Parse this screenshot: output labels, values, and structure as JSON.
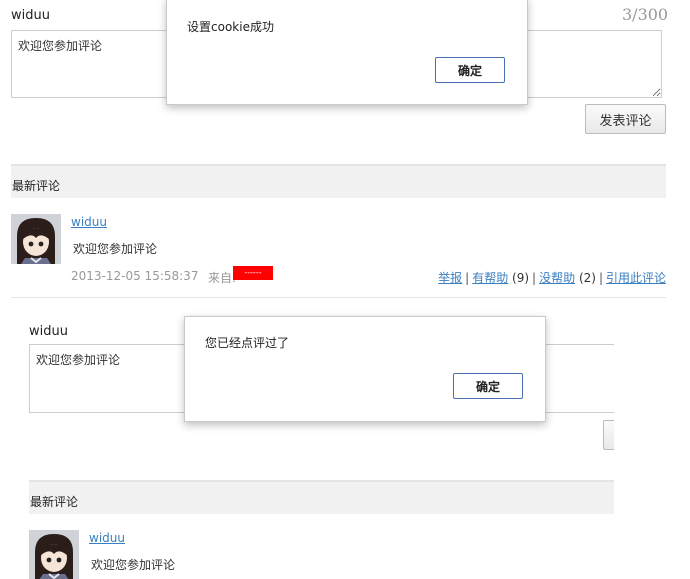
{
  "top": {
    "username": "widuu",
    "counter": "3/300",
    "comment_value": "欢迎您参加评论",
    "submit_label": "发表评论",
    "section_title": "最新评论",
    "comment": {
      "author": "widuu",
      "text": "欢迎您参加评论",
      "timestamp": "2013-12-05 15:58:37",
      "source_label": "来自:",
      "source_tag": "------",
      "actions": {
        "report": "举报",
        "helpful": "有帮助",
        "helpful_count": "(9)",
        "not_helpful": "没帮助",
        "not_helpful_count": "(2)",
        "quote": "引用此评论"
      },
      "separator": "|"
    }
  },
  "dialog_top": {
    "message": "设置cookie成功",
    "ok_label": "确定"
  },
  "bottom": {
    "username": "widuu",
    "comment_value": "欢迎您参加评论",
    "section_title": "最新评论",
    "comment": {
      "author": "widuu",
      "text": "欢迎您参加评论"
    }
  },
  "dialog_bottom": {
    "message": "您已经点评过了",
    "ok_label": "确定"
  },
  "colors": {
    "link": "#3a7fc1",
    "tag_red": "#ff0000",
    "dialog_button_border": "#4a6fb5"
  }
}
